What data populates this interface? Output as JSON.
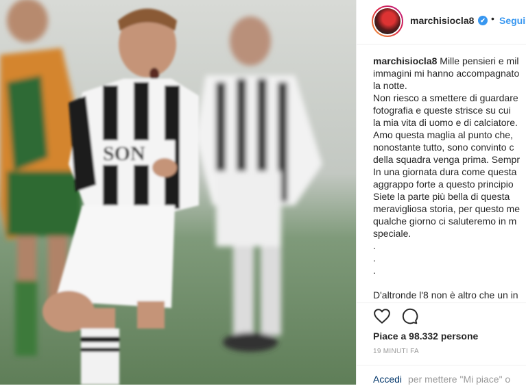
{
  "post": {
    "username": "marchisiocla8",
    "verified_mark": "✔",
    "separator": "•",
    "follow_label": "Segui",
    "caption_username": "marchisiocla8",
    "caption_lines": [
      "Mille pensieri e mil",
      "immagini mi hanno accompagnato",
      "la notte.",
      "Non riesco a smettere di guardare",
      "fotografia e queste strisce su cui",
      "la mia vita di uomo e di calciatore.",
      "Amo questa maglia al punto che,",
      "nonostante tutto, sono convinto c",
      "della squadra venga prima. Sempr",
      "In una giornata dura come questa",
      "aggrappo forte a questo principio",
      "Siete la parte più bella di questa",
      "meravigliosa storia, per questo me",
      "qualche giorno ci saluteremo in m",
      "speciale.",
      ".",
      ".",
      ".",
      "",
      "D'altronde l'8 non è altro che un in"
    ],
    "likes_text": "Piace a 98.332 persone",
    "timestamp": "19 MINUTI FA",
    "login_link": "Accedi",
    "login_text": "per mettere \"Mi piace\" o",
    "icons": {
      "like": "heart-icon",
      "comment": "comment-icon"
    },
    "colors": {
      "accent": "#3897f0",
      "muted": "#999999",
      "border": "#efefef"
    }
  }
}
